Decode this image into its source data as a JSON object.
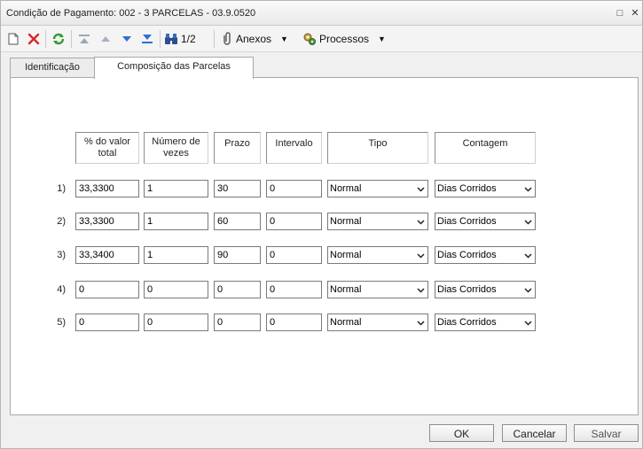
{
  "window": {
    "title": "Condição de Pagamento: 002 - 3 PARCELAS - 03.9.0520",
    "restore_glyph": "□",
    "close_glyph": "✕"
  },
  "toolbar": {
    "record_pos": "1/2",
    "anexos_label": "Anexos",
    "processos_label": "Processos",
    "caret": "▼"
  },
  "tabs": [
    {
      "label": "Identificação"
    },
    {
      "label": "Composição das Parcelas",
      "active": true
    }
  ],
  "table": {
    "headers": {
      "pct": "% do valor total",
      "numero": "Número de vezes",
      "prazo": "Prazo",
      "intervalo": "Intervalo",
      "tipo": "Tipo",
      "contagem": "Contagem"
    },
    "rows": [
      {
        "num": "1)",
        "pct": "33,3300",
        "numero": "1",
        "prazo": "30",
        "intervalo": "0",
        "tipo": "Normal",
        "contagem": "Dias Corridos"
      },
      {
        "num": "2)",
        "pct": "33,3300",
        "numero": "1",
        "prazo": "60",
        "intervalo": "0",
        "tipo": "Normal",
        "contagem": "Dias Corridos"
      },
      {
        "num": "3)",
        "pct": "33,3400",
        "numero": "1",
        "prazo": "90",
        "intervalo": "0",
        "tipo": "Normal",
        "contagem": "Dias Corridos"
      },
      {
        "num": "4)",
        "pct": "0",
        "numero": "0",
        "prazo": "0",
        "intervalo": "0",
        "tipo": "Normal",
        "contagem": "Dias Corridos"
      },
      {
        "num": "5)",
        "pct": "0",
        "numero": "0",
        "prazo": "0",
        "intervalo": "0",
        "tipo": "Normal",
        "contagem": "Dias Corridos"
      }
    ]
  },
  "footer": {
    "ok_label": "OK",
    "cancel_label": "Cancelar",
    "save_label": "Salvar"
  },
  "colors": {
    "delete_red": "#d9262b",
    "refresh_green": "#2f9a2f",
    "nav_blue": "#2f6fd3"
  }
}
